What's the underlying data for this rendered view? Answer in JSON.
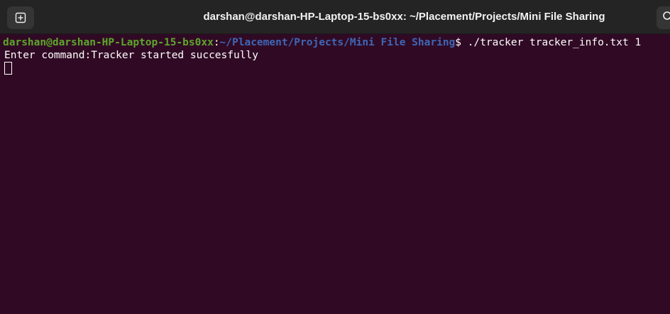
{
  "window": {
    "title": "darshan@darshan-HP-Laptop-15-bs0xx: ~/Placement/Projects/Mini File Sharing"
  },
  "terminal": {
    "prompt_user": "darshan@darshan-HP-Laptop-15-bs0xx",
    "prompt_colon": ":",
    "prompt_path": "~/Placement/Projects/Mini File Sharing",
    "prompt_dollar": "$",
    "command": " ./tracker tracker_info.txt 1",
    "output_line": "Enter command:Tracker started succesfully"
  },
  "icons": {
    "new_tab": "new-tab-icon",
    "search": "search-icon"
  },
  "colors": {
    "background": "#300a24",
    "titlebar": "#242424",
    "prompt_user": "#5fa62c",
    "prompt_path": "#3f66b5",
    "text": "#ffffff"
  }
}
